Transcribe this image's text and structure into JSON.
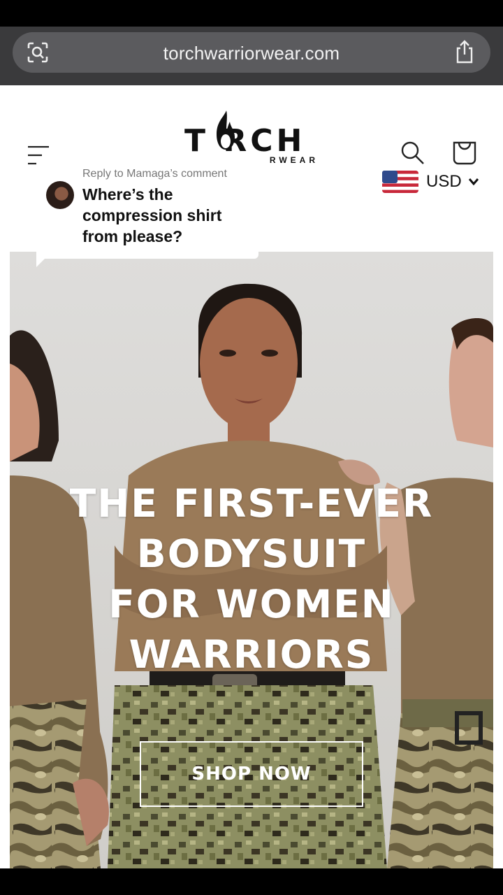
{
  "browser": {
    "url": "torchwarriorwear.com",
    "lens_icon": "visual-search-icon",
    "share_icon": "share-icon"
  },
  "header": {
    "logo_text": "T  RCH",
    "logo_subtext": "RWEAR",
    "menu_icon": "hamburger-menu-icon",
    "search_icon": "search-icon",
    "cart_icon": "shopping-bag-icon",
    "currency": "USD"
  },
  "reply": {
    "meta": "Reply to Mamaga’s comment",
    "text": "Where’s the compression shirt from please?"
  },
  "hero": {
    "headline": [
      "THE FIRST-EVER",
      "BODYSUIT",
      "FOR WOMEN",
      "WARRIORS"
    ],
    "cta_label": "SHOP NOW"
  },
  "colors": {
    "browser_bar": "#3a3a3c",
    "url_pill": "#5b5b5e",
    "hero_background": "#d9d8d5",
    "shirt_tan": "#9a7a58"
  }
}
